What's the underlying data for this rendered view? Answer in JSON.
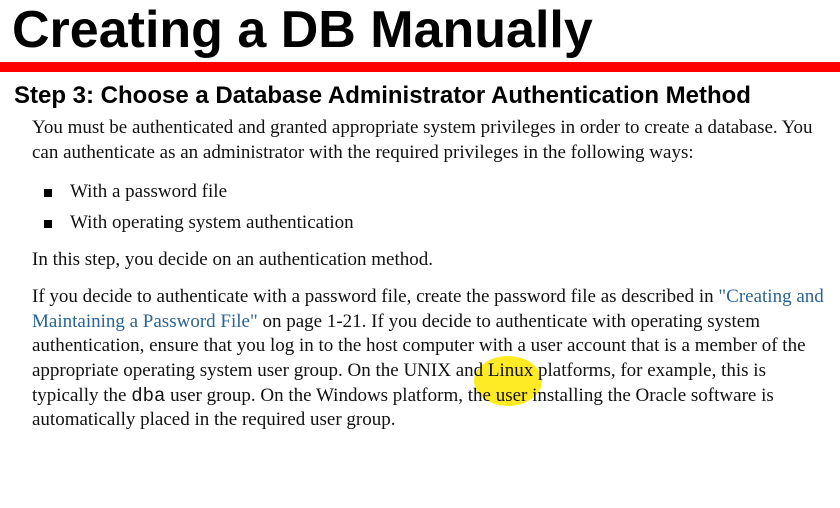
{
  "title": "Creating a DB Manually",
  "step_heading": "Step 3: Choose a Database Administrator Authentication Method",
  "intro": "You must be authenticated and granted appropriate system privileges in order to create a database. You can authenticate as an administrator with the required privileges in the following ways:",
  "bullets": [
    "With a password file",
    "With operating system authentication"
  ],
  "decide": "In this step, you decide on an authentication method.",
  "p3_pre": "If you decide to authenticate with a password file, create the password file as described in ",
  "p3_link": "\"Creating and Maintaining a Password File\"",
  "p3_mid1": " on page 1-21. If you decide to authenticate with operating system authentication, ensure that you log in to the host computer with a user account that is a member of the appropriate operating system user group. On the UNIX and ",
  "p3_hl": "Linux",
  "p3_mid2": " platforms, for example, this is typically the ",
  "p3_mono": "dba",
  "p3_end": " user group. On the Windows platform, the user installing the Oracle software is automatically placed in the required user group.",
  "link_page_ref": "1-21"
}
